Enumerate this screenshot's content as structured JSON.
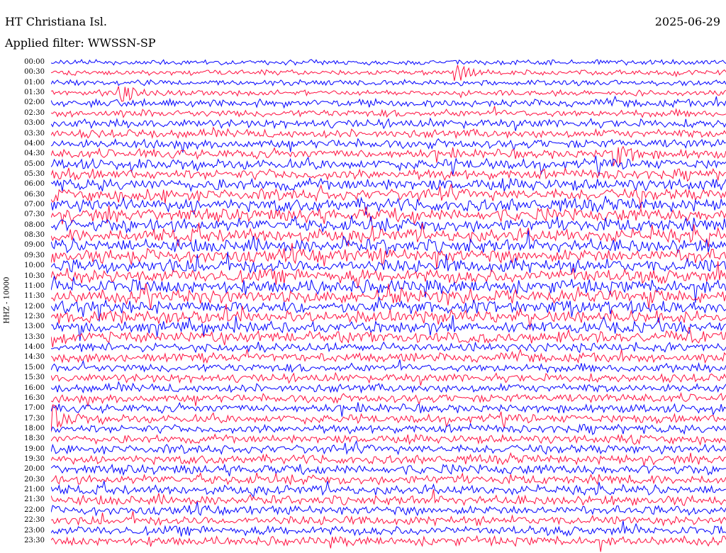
{
  "header": {
    "station": "HT Christiana Isl.",
    "date": "2025-06-29",
    "filter_label": "Applied filter: WWSSN-SP"
  },
  "colors": {
    "trace_a": "#0000ff",
    "trace_b": "#ff1040",
    "background": "#ffffff"
  },
  "chart_data": {
    "type": "line",
    "title": "HT Christiana Isl.",
    "ylabel": "HHZ - 10000",
    "xlabel": "",
    "y_tick_labels": [
      "00:00",
      "00:30",
      "01:00",
      "01:30",
      "02:00",
      "02:30",
      "03:00",
      "03:30",
      "04:00",
      "04:30",
      "05:00",
      "05:30",
      "06:00",
      "06:30",
      "07:00",
      "07:30",
      "08:00",
      "08:30",
      "09:00",
      "09:30",
      "10:00",
      "10:30",
      "11:00",
      "11:30",
      "12:00",
      "12:30",
      "13:00",
      "13:30",
      "14:00",
      "14:30",
      "15:00",
      "15:30",
      "16:00",
      "16:30",
      "17:00",
      "17:30",
      "18:00",
      "18:30",
      "19:00",
      "19:30",
      "20:00",
      "20:30",
      "21:00",
      "21:30",
      "22:00",
      "22:30",
      "23:00",
      "23:30"
    ],
    "traces_per_row": 2,
    "trace_colors": [
      "blue",
      "red"
    ],
    "activity_by_hour": [
      0.25,
      0.28,
      0.45,
      0.55,
      0.6,
      0.7,
      0.85,
      0.95,
      1.0,
      1.0,
      1.0,
      1.0,
      0.95,
      0.8,
      0.6,
      0.55,
      0.55,
      0.55,
      0.55,
      0.6,
      0.65,
      0.65,
      0.6,
      0.6
    ],
    "events": [
      {
        "time": "00:48",
        "label": "",
        "strength": 0.6
      },
      {
        "time": "01:33",
        "label": "",
        "strength": 0.8
      },
      {
        "time": "04:55",
        "label": "",
        "strength": 0.9
      },
      {
        "time": "17:30",
        "label": "",
        "strength": 0.9
      }
    ]
  }
}
